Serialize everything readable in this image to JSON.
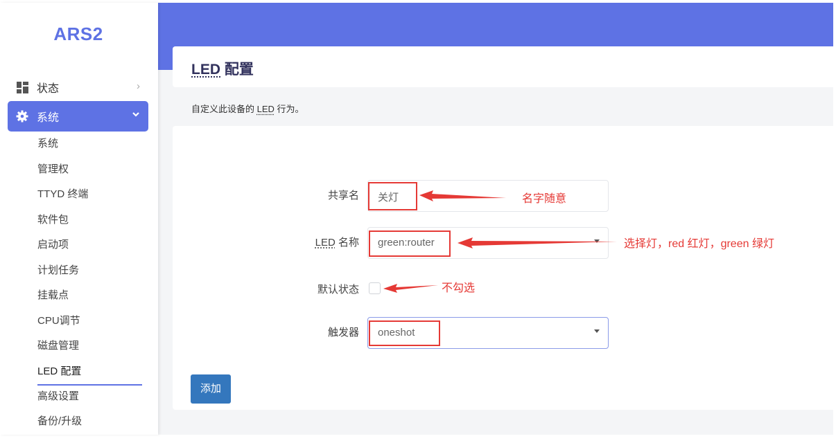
{
  "app": {
    "brand": "ARS2"
  },
  "sidebar": {
    "status_label": "状态",
    "system_label": "系统",
    "sub_items": [
      {
        "label": "系统"
      },
      {
        "label": "管理权"
      },
      {
        "label": "TTYD 终端"
      },
      {
        "label": "软件包"
      },
      {
        "label": "启动项"
      },
      {
        "label": "计划任务"
      },
      {
        "label": "挂载点"
      },
      {
        "label": "CPU调节"
      },
      {
        "label": "磁盘管理"
      },
      {
        "label": "LED 配置"
      },
      {
        "label": "高级设置"
      },
      {
        "label": "备份/升级"
      }
    ],
    "active_item": "LED 配置"
  },
  "page": {
    "title_abbr": "LED",
    "title_rest": " 配置",
    "desc_pre": "自定义此设备的 ",
    "desc_abbr": "LED",
    "desc_post": " 行为。"
  },
  "form": {
    "name_label": "共享名",
    "name_value": "关灯",
    "led_label_abbr": "LED",
    "led_label_rest": " 名称",
    "led_value": "green:router",
    "default_state_label": "默认状态",
    "trigger_label": "触发器",
    "trigger_value": "oneshot",
    "add_button": "添加"
  },
  "annotations": {
    "name_note": "名字随意",
    "led_note": "选择灯，red 红灯，green 绿灯",
    "checkbox_note": "不勾选"
  },
  "colors": {
    "accent": "#5e72e4",
    "button": "#3477bd",
    "annotation": "#e53935"
  }
}
